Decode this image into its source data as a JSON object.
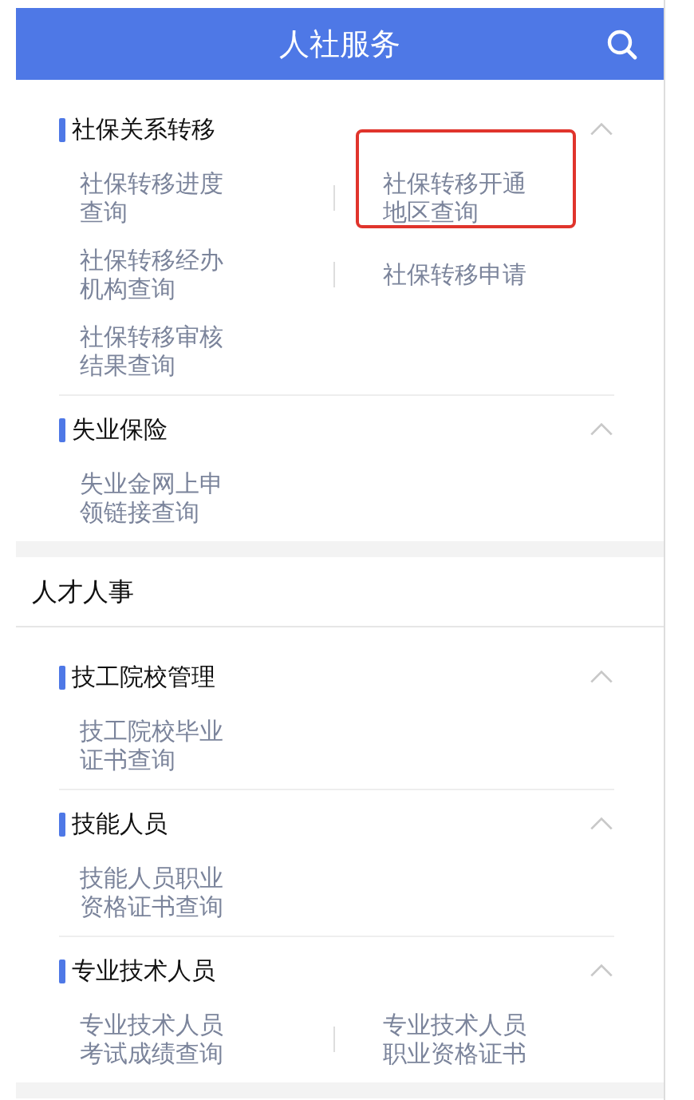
{
  "header": {
    "title": "人社服务"
  },
  "sections": [
    {
      "groups": [
        {
          "title": "社保关系转移",
          "expanded": true,
          "items": [
            {
              "label": "社保转移进度查询",
              "highlighted": false
            },
            {
              "label": "社保转移开通地区查询",
              "highlighted": true
            },
            {
              "label": "社保转移经办机构查询",
              "highlighted": false
            },
            {
              "label": "社保转移申请",
              "highlighted": false
            },
            {
              "label": "社保转移审核结果查询",
              "highlighted": false
            }
          ]
        },
        {
          "title": "失业保险",
          "expanded": true,
          "items": [
            {
              "label": "失业金网上申领链接查询",
              "highlighted": false
            }
          ]
        }
      ]
    },
    {
      "title": "人才人事",
      "groups": [
        {
          "title": "技工院校管理",
          "expanded": true,
          "items": [
            {
              "label": "技工院校毕业证书查询",
              "highlighted": false
            }
          ]
        },
        {
          "title": "技能人员",
          "expanded": true,
          "items": [
            {
              "label": "技能人员职业资格证书查询",
              "highlighted": false
            }
          ]
        },
        {
          "title": "专业技术人员",
          "expanded": true,
          "items": [
            {
              "label": "专业技术人员考试成绩查询",
              "highlighted": false
            },
            {
              "label": "专业技术人员职业资格证书",
              "highlighted": false
            }
          ]
        }
      ]
    }
  ]
}
